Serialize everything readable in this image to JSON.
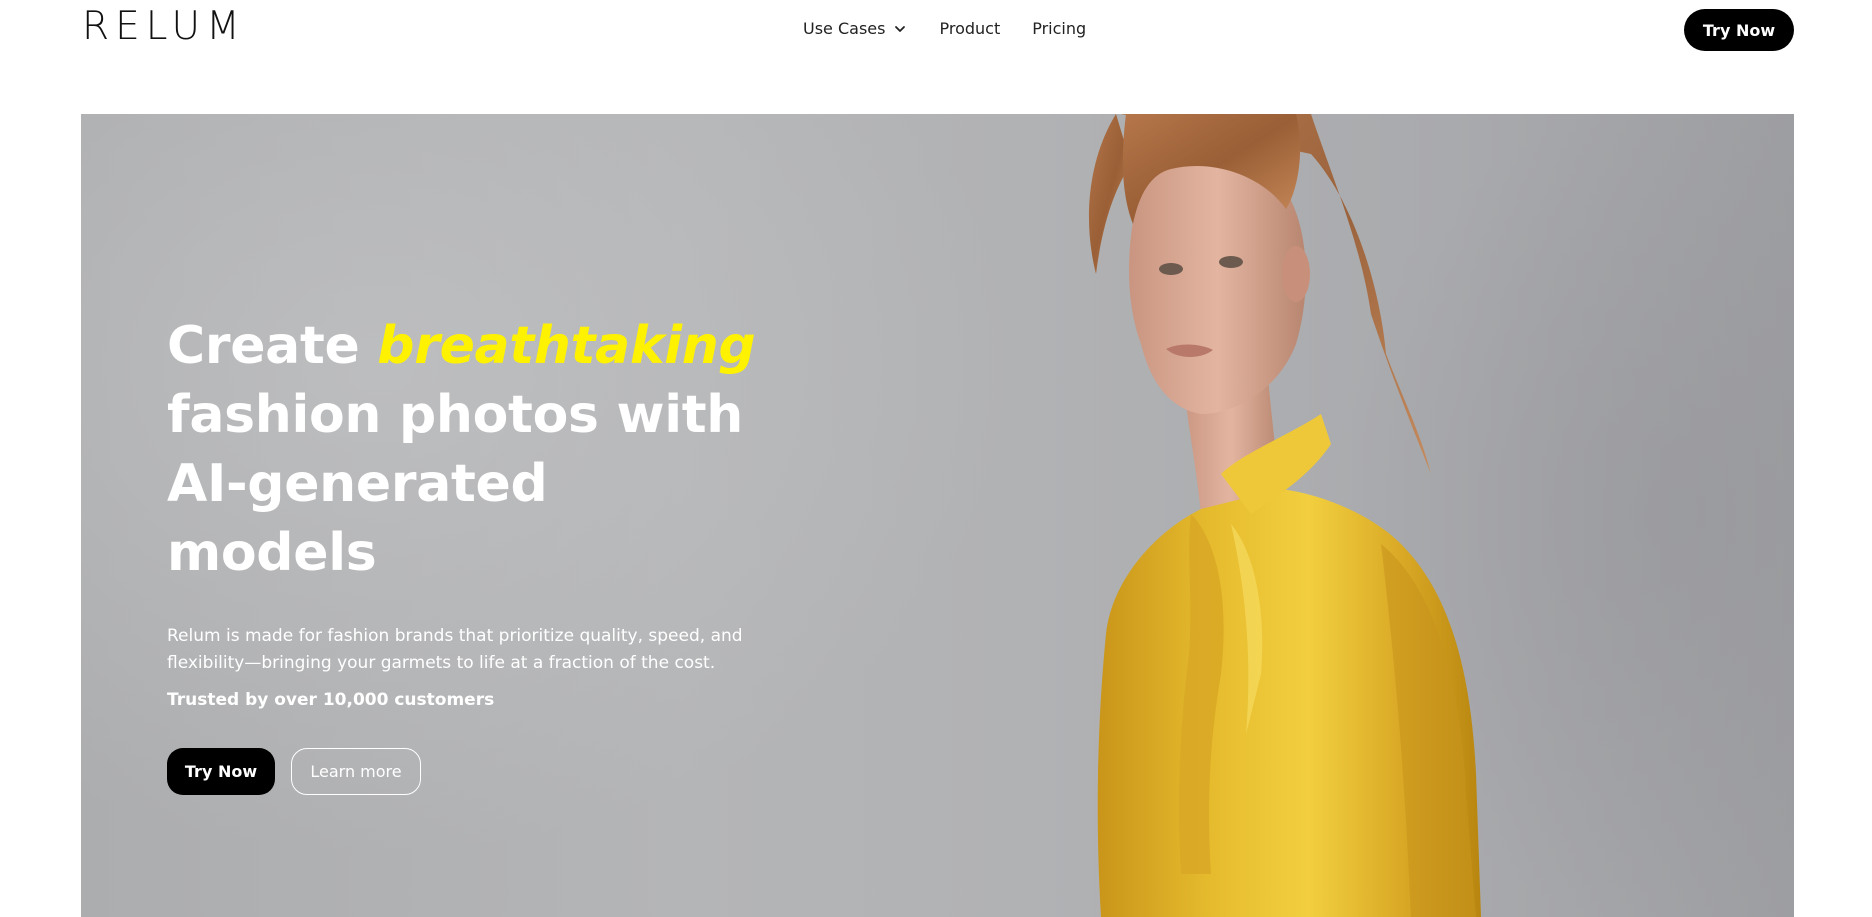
{
  "header": {
    "logo": "RELUM",
    "nav": [
      {
        "label": "Use Cases",
        "has_dropdown": true,
        "icon": "chevron-down-icon"
      },
      {
        "label": "Product"
      },
      {
        "label": "Pricing"
      }
    ],
    "cta_label": "Try Now"
  },
  "hero": {
    "headline_prefix": "Create ",
    "headline_accent": "breathtaking",
    "headline_line2": "fashion photos with",
    "headline_line3": "AI-generated",
    "headline_line4": "models",
    "subtitle": "Relum is made for fashion brands that prioritize quality, speed, and flexibility—bringing your garmets to life at a fraction of the cost.",
    "trust": "Trusted by over 10,000 customers",
    "primary_button": "Try Now",
    "secondary_button": "Learn more",
    "image": "fashion-model-in-yellow-satin-blouse"
  },
  "colors": {
    "accent": "#fff200",
    "button_bg": "#000000",
    "hero_bg": "#b0b1b3",
    "garment": "#e0b52a"
  }
}
